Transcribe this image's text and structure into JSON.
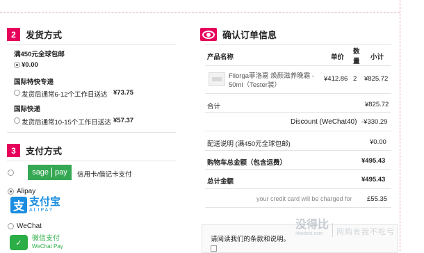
{
  "shipping": {
    "step": "2",
    "title": "发货方式",
    "free_note": "满450元全球包邮",
    "free_price": "¥0.00",
    "express_title": "国际特快专递",
    "express_desc": "发货后通常6-12个工作日送达",
    "express_price": "¥73.75",
    "standard_title": "国际快递",
    "standard_desc": "发货后通常10-15个工作日送达",
    "standard_price": "¥57.37"
  },
  "payment": {
    "step": "3",
    "title": "支付方式",
    "sagepay_a": "sage",
    "sagepay_b": "pay",
    "card_label": "信用卡/借记卡支付",
    "alipay_label": "Alipay",
    "alipay_cn": "支付宝",
    "alipay_en": "ALIPAY",
    "wechat_label": "WeChat",
    "wechat_cn": "微信支付",
    "wechat_en": "WeChat Pay"
  },
  "order": {
    "title": "确认订单信息",
    "col_product": "产品名称",
    "col_price": "单价",
    "col_qty_1": "数",
    "col_qty_2": "量",
    "col_subtotal": "小计",
    "product_line1": "Filorga菲洛嘉 焕颜滋养晚霜 -",
    "product_line2": "50ml（Tester装）",
    "product_price": "¥412.86",
    "product_qty": "2",
    "product_subtotal": "¥825.72",
    "subtotal_label": "合计",
    "subtotal_value": "¥825.72",
    "discount_label": "Discount (WeChat40)",
    "discount_value": "-¥330.29",
    "shipping_label": "配送说明 (满450元全球包邮)",
    "shipping_value": "¥0.00",
    "cart_total_label": "购物车总金额（包含运费）",
    "cart_total_value": "¥495.43",
    "grand_total_label": "总计金额",
    "grand_total_value": "¥495.43",
    "credit_note": "your credit card will be charged for",
    "credit_value": "£55.35",
    "terms_text": "请阅读我们的条款和说明。"
  },
  "watermark": {
    "logo": "没得比",
    "sub": "Meidebi.com",
    "slogan": "网购有我不吃亏"
  },
  "colors": {
    "accent": "#e6005c",
    "sagepay": "#34a853",
    "alipay": "#1a8de0",
    "wechat": "#2aae45"
  }
}
